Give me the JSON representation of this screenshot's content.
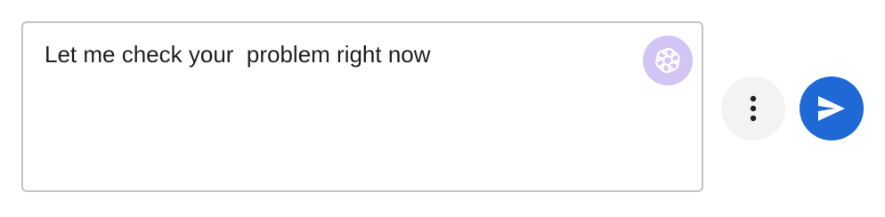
{
  "composer": {
    "message_text": "Let me check your  problem right now",
    "ai_badge_icon": "openai-logo-icon",
    "ai_badge_color": "#d3c4f6"
  },
  "actions": {
    "more_icon": "more-vertical-icon",
    "send_icon": "send-icon",
    "send_color": "#1f69d6",
    "more_bg_color": "#f3f3f3"
  }
}
